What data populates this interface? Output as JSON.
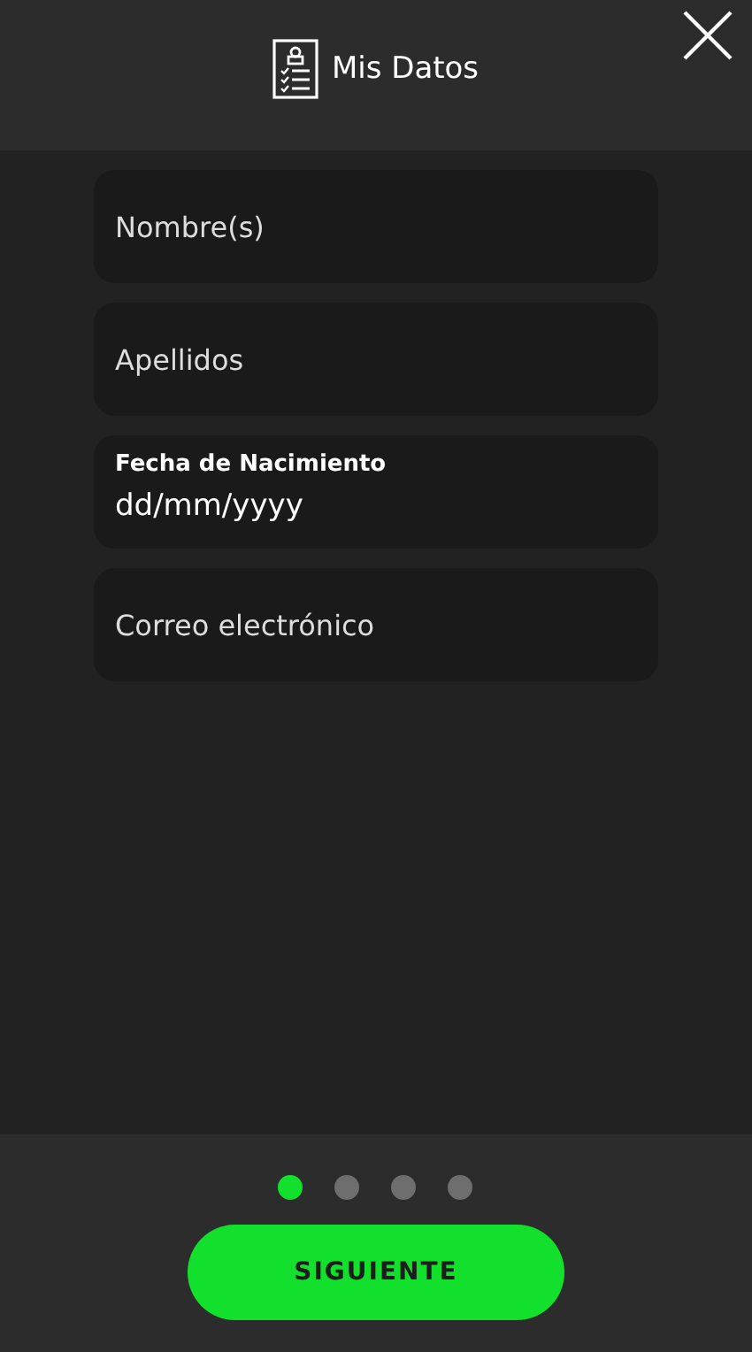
{
  "header": {
    "title": "Mis Datos"
  },
  "fields": [
    {
      "kind": "plain",
      "placeholder": "Nombre(s)"
    },
    {
      "kind": "plain",
      "placeholder": "Apellidos"
    },
    {
      "kind": "labeled",
      "label": "Fecha de Nacimiento",
      "placeholder": "dd/mm/yyyy"
    },
    {
      "kind": "plain",
      "placeholder": "Correo electrónico"
    }
  ],
  "steps": [
    {
      "selected": true
    },
    {
      "selected": false
    },
    {
      "selected": false
    },
    {
      "selected": false
    }
  ],
  "button": {
    "label": "SIGUIENTE"
  }
}
